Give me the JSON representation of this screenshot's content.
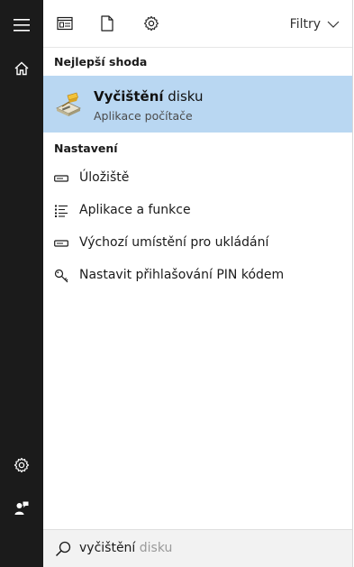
{
  "filters_label": "Filtry",
  "sections": {
    "best_match": "Nejlepší shoda",
    "settings": "Nastavení"
  },
  "best_match": {
    "title_bold": "Vyčištění",
    "title_rest": " disku",
    "subtitle": "Aplikace počítače",
    "icon": "disk-cleanup-icon"
  },
  "settings_items": [
    {
      "label": "Úložiště",
      "icon": "storage-icon"
    },
    {
      "label": "Aplikace a funkce",
      "icon": "apps-list-icon"
    },
    {
      "label": "Výchozí umístění pro ukládání",
      "icon": "storage-icon"
    },
    {
      "label": "Nastavit přihlašování PIN kódem",
      "icon": "key-icon"
    }
  ],
  "search": {
    "typed": "vyčištění",
    "suggestion": " disku"
  },
  "colors": {
    "sidebar": "#1b1b1b",
    "selection": "#b9d7f2",
    "searchbar": "#f2f2f2"
  }
}
